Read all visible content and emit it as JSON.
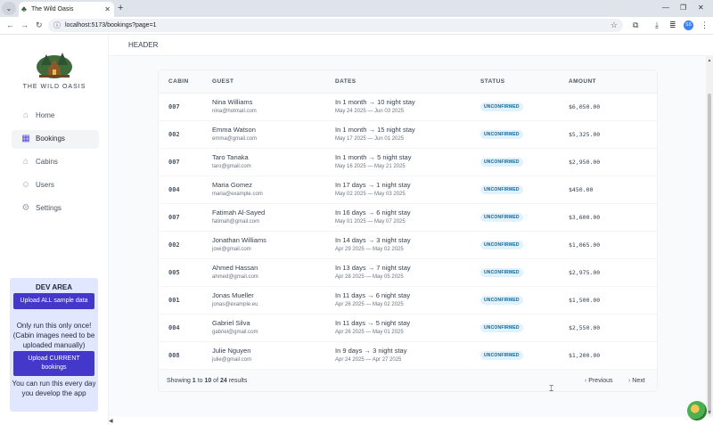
{
  "browser": {
    "tab_title": "The Wild Oasis",
    "url": "localhost:5173/bookings?page=1",
    "profile_initials": "SS"
  },
  "sidebar": {
    "logo_text": "THE WILD OASIS",
    "items": [
      {
        "label": "Home",
        "icon": "home-icon",
        "active": false
      },
      {
        "label": "Bookings",
        "icon": "calendar-icon",
        "active": true
      },
      {
        "label": "Cabins",
        "icon": "cabin-icon",
        "active": false
      },
      {
        "label": "Users",
        "icon": "users-icon",
        "active": false
      },
      {
        "label": "Settings",
        "icon": "settings-icon",
        "active": false
      }
    ],
    "dev": {
      "title": "DEV AREA",
      "upload_all": "Upload ALL sample data",
      "note1": "Only run this only once! (Cabin images need to be uploaded manually)",
      "upload_current": "Upload CURRENT bookings",
      "note2": "You can run this every day you develop the app"
    }
  },
  "header": {
    "text": "HEADER"
  },
  "table": {
    "columns": [
      "CABIN",
      "GUEST",
      "DATES",
      "STATUS",
      "AMOUNT"
    ],
    "rows": [
      {
        "cabin": "007",
        "name": "Nina Williams",
        "email": "nina@hotmail.com",
        "dates": "In 1 month → 10 night stay",
        "range": "May 24 2025 — Jun 03 2025",
        "status": "UNCONFIRMED",
        "amount": "$6,050.00"
      },
      {
        "cabin": "002",
        "name": "Emma Watson",
        "email": "emma@gmail.com",
        "dates": "In 1 month → 15 night stay",
        "range": "May 17 2025 — Jun 01 2025",
        "status": "UNCONFIRMED",
        "amount": "$5,325.00"
      },
      {
        "cabin": "007",
        "name": "Taro Tanaka",
        "email": "taro@gmail.com",
        "dates": "In 1 month → 5 night stay",
        "range": "May 16 2025 — May 21 2025",
        "status": "UNCONFIRMED",
        "amount": "$2,950.00"
      },
      {
        "cabin": "004",
        "name": "Maria Gomez",
        "email": "maria@example.com",
        "dates": "In 17 days → 1 night stay",
        "range": "May 02 2025 — May 03 2025",
        "status": "UNCONFIRMED",
        "amount": "$450.00"
      },
      {
        "cabin": "007",
        "name": "Fatimah Al-Sayed",
        "email": "fatimah@gmail.com",
        "dates": "In 16 days → 6 night stay",
        "range": "May 01 2025 — May 07 2025",
        "status": "UNCONFIRMED",
        "amount": "$3,600.00"
      },
      {
        "cabin": "002",
        "name": "Jonathan Williams",
        "email": "jowi@gmail.com",
        "dates": "In 14 days → 3 night stay",
        "range": "Apr 29 2025 — May 02 2025",
        "status": "UNCONFIRMED",
        "amount": "$1,065.00"
      },
      {
        "cabin": "005",
        "name": "Ahmed Hassan",
        "email": "ahmed@gmail.com",
        "dates": "In 13 days → 7 night stay",
        "range": "Apr 28 2025 — May 05 2025",
        "status": "UNCONFIRMED",
        "amount": "$2,975.00"
      },
      {
        "cabin": "001",
        "name": "Jonas Mueller",
        "email": "jonas@example.eu",
        "dates": "In 11 days → 6 night stay",
        "range": "Apr 26 2025 — May 02 2025",
        "status": "UNCONFIRMED",
        "amount": "$1,500.00"
      },
      {
        "cabin": "004",
        "name": "Gabriel Silva",
        "email": "gabriel@gmail.com",
        "dates": "In 11 days → 5 night stay",
        "range": "Apr 26 2025 — May 01 2025",
        "status": "UNCONFIRMED",
        "amount": "$2,550.00"
      },
      {
        "cabin": "008",
        "name": "Julie Nguyen",
        "email": "julie@gmail.com",
        "dates": "In 9 days → 3 night stay",
        "range": "Apr 24 2025 — Apr 27 2025",
        "status": "UNCONFIRMED",
        "amount": "$1,200.00"
      }
    ]
  },
  "footer": {
    "showing_pre": "Showing ",
    "from": "1",
    "to_word": " to ",
    "to": "10",
    "of_word": " of ",
    "total": "24",
    "results_word": " results",
    "previous": "Previous",
    "next": "Next"
  },
  "colors": {
    "accent": "#4f46e5",
    "status_bg": "#e0f2fe",
    "status_text": "#0369a1",
    "dev_bg": "#e0e7ff",
    "dev_button": "#4338ca"
  }
}
